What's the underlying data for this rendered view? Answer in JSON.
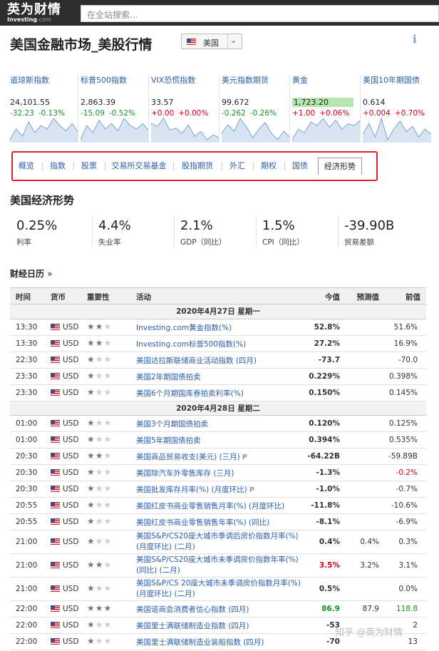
{
  "header": {
    "logo_cn": "英为财情",
    "logo_en": "Investing",
    "logo_en_suffix": ".com",
    "search_placeholder": "在全站搜索..."
  },
  "page_title": "美国金融市场_美股行情",
  "region_selector": {
    "label": "美国"
  },
  "info_icon": "i",
  "tickers": [
    {
      "name": "道琼斯指数",
      "price": "24,101.55",
      "change": "-32.23",
      "pct": "-0.13%",
      "dir": "neg",
      "spark": [
        20,
        26,
        22,
        30,
        24,
        28,
        26,
        32,
        28,
        25,
        29,
        24
      ]
    },
    {
      "name": "标普500指数",
      "price": "2,863.39",
      "change": "-15.09",
      "pct": "-0.52%",
      "dir": "neg",
      "spark": [
        22,
        30,
        26,
        33,
        28,
        31,
        27,
        34,
        30,
        28,
        31,
        27
      ]
    },
    {
      "name": "VIX恐慌指数",
      "price": "33.57",
      "change": "+0.00",
      "pct": "+0.00%",
      "dir": "pos",
      "spark": [
        30,
        28,
        33,
        26,
        27,
        24,
        29,
        22,
        25,
        20,
        23,
        21
      ]
    },
    {
      "name": "美元指数期货",
      "price": "99.672",
      "change": "-0.262",
      "pct": "-0.26%",
      "dir": "neg",
      "spark": [
        26,
        30,
        27,
        33,
        29,
        24,
        28,
        31,
        26,
        23,
        27,
        24
      ]
    },
    {
      "name": "黄金",
      "price": "1,723.20",
      "change": "+1.00",
      "pct": "+0.06%",
      "dir": "pos",
      "highlight": true,
      "spark": [
        22,
        28,
        26,
        32,
        30,
        34,
        29,
        33,
        28,
        31,
        30,
        33
      ]
    },
    {
      "name": "美国10年期国债",
      "price": "0.614",
      "change": "+0.004",
      "pct": "+0.70%",
      "dir": "pos",
      "spark": [
        28,
        32,
        27,
        34,
        26,
        30,
        33,
        29,
        31,
        27,
        30,
        28
      ]
    }
  ],
  "tabs": [
    "概览",
    "指数",
    "股票",
    "交易所交易基金",
    "股指期货",
    "外汇",
    "期权",
    "国债",
    "经济形势"
  ],
  "active_tab": "经济形势",
  "economy": {
    "title": "美国经济形势",
    "stats": [
      {
        "value": "0.25%",
        "label": "利率"
      },
      {
        "value": "4.4%",
        "label": "失业率"
      },
      {
        "value": "2.1%",
        "label": "GDP（同比）"
      },
      {
        "value": "1.5%",
        "label": "CPI（同比）"
      },
      {
        "value": "-39.90B",
        "label": "贸易差额"
      }
    ]
  },
  "calendar": {
    "title": "财经日历",
    "arrow": "»",
    "headers": {
      "time": "时间",
      "currency": "货币",
      "importance": "重要性",
      "event": "活动",
      "actual": "今值",
      "forecast": "预测值",
      "previous": "前值"
    },
    "days": [
      {
        "label": "2020年4月27日 星期一",
        "rows": [
          {
            "time": "13:30",
            "cur": "USD",
            "imp": 2,
            "event": "Investing.com黄金指数(%)",
            "actual": "52.8%",
            "forecast": "",
            "previous": "51.6%"
          },
          {
            "time": "13:30",
            "cur": "USD",
            "imp": 2,
            "event": "Investing.com标普500指数(%)",
            "actual": "27.2%",
            "forecast": "",
            "previous": "16.9%"
          },
          {
            "time": "22:30",
            "cur": "USD",
            "imp": 1,
            "event": "美国达拉斯联储商业活动指数 (四月)",
            "actual": "-73.7",
            "forecast": "",
            "previous": "-70.0"
          },
          {
            "time": "23:30",
            "cur": "USD",
            "imp": 1,
            "event": "美国2年期国债拍卖",
            "actual": "0.229%",
            "forecast": "",
            "previous": "0.398%"
          },
          {
            "time": "23:30",
            "cur": "USD",
            "imp": 1,
            "event": "美国6个月期国库券拍卖利率(%)",
            "actual": "0.150%",
            "forecast": "",
            "previous": "0.145%"
          }
        ]
      },
      {
        "label": "2020年4月28日 星期二",
        "rows": [
          {
            "time": "01:00",
            "cur": "USD",
            "imp": 1,
            "event": "美国3个月期国债拍卖",
            "actual": "0.120%",
            "forecast": "",
            "previous": "0.125%"
          },
          {
            "time": "01:00",
            "cur": "USD",
            "imp": 1,
            "event": "美国5年期国债拍卖",
            "actual": "0.394%",
            "forecast": "",
            "previous": "0.535%"
          },
          {
            "time": "20:30",
            "cur": "USD",
            "imp": 2,
            "event": "美国商品贸易收支(美元) (三月)",
            "p": true,
            "actual": "-64.22B",
            "forecast": "",
            "previous": "-59.89B"
          },
          {
            "time": "20:30",
            "cur": "USD",
            "imp": 1,
            "event": "美国除汽车外零售库存 (三月)",
            "actual": "-1.3%",
            "forecast": "",
            "previous": "-0.2%",
            "prevColor": "red"
          },
          {
            "time": "20:30",
            "cur": "USD",
            "imp": 1,
            "event": "美国批发库存月率(%) (月度环比)",
            "p": true,
            "actual": "-1.0%",
            "forecast": "",
            "previous": "-0.7%"
          },
          {
            "time": "20:55",
            "cur": "USD",
            "imp": 1,
            "event": "美国红皮书商业零售销售月率(%) (月度环比)",
            "actual": "-11.8%",
            "forecast": "",
            "previous": "-10.6%"
          },
          {
            "time": "20:55",
            "cur": "USD",
            "imp": 1,
            "event": "美国红皮书商业零售销售年率(%) (同比)",
            "actual": "-8.1%",
            "forecast": "",
            "previous": "-6.9%"
          },
          {
            "time": "21:00",
            "cur": "USD",
            "imp": 1,
            "event": "美国S&P/CS20座大城市季调后房价指数月率(%) (月度环比) (二月)",
            "actual": "0.4%",
            "forecast": "0.4%",
            "previous": "0.3%"
          },
          {
            "time": "21:00",
            "cur": "USD",
            "imp": 2,
            "event": "美国S&P/CS20座大城市未季调房价指数年率(%) (同比) (二月)",
            "actual": "3.5%",
            "actualColor": "red",
            "forecast": "3.2%",
            "previous": "3.1%"
          },
          {
            "time": "21:00",
            "cur": "USD",
            "imp": 1,
            "event": "美国S&P/CS 20座大城市未季调房价指数月率(%) (月度环比) (二月)",
            "actual": "0.5%",
            "forecast": "",
            "previous": "0.0%"
          },
          {
            "time": "22:00",
            "cur": "USD",
            "imp": 3,
            "event": "美国谘商会消费者信心指数 (四月)",
            "actual": "86.9",
            "actualColor": "green",
            "forecast": "87.9",
            "previous": "118.8",
            "prevColor": "green"
          },
          {
            "time": "22:00",
            "cur": "USD",
            "imp": 1,
            "event": "美国里士满联储制造业指数 (四月)",
            "actual": "-53",
            "forecast": "",
            "previous": "2"
          },
          {
            "time": "22:00",
            "cur": "USD",
            "imp": 1,
            "event": "美国里士满联储制造业装船指数 (四月)",
            "actual": "-70",
            "forecast": "",
            "previous": "13"
          }
        ]
      }
    ]
  },
  "watermark": "知乎 @英为财情"
}
